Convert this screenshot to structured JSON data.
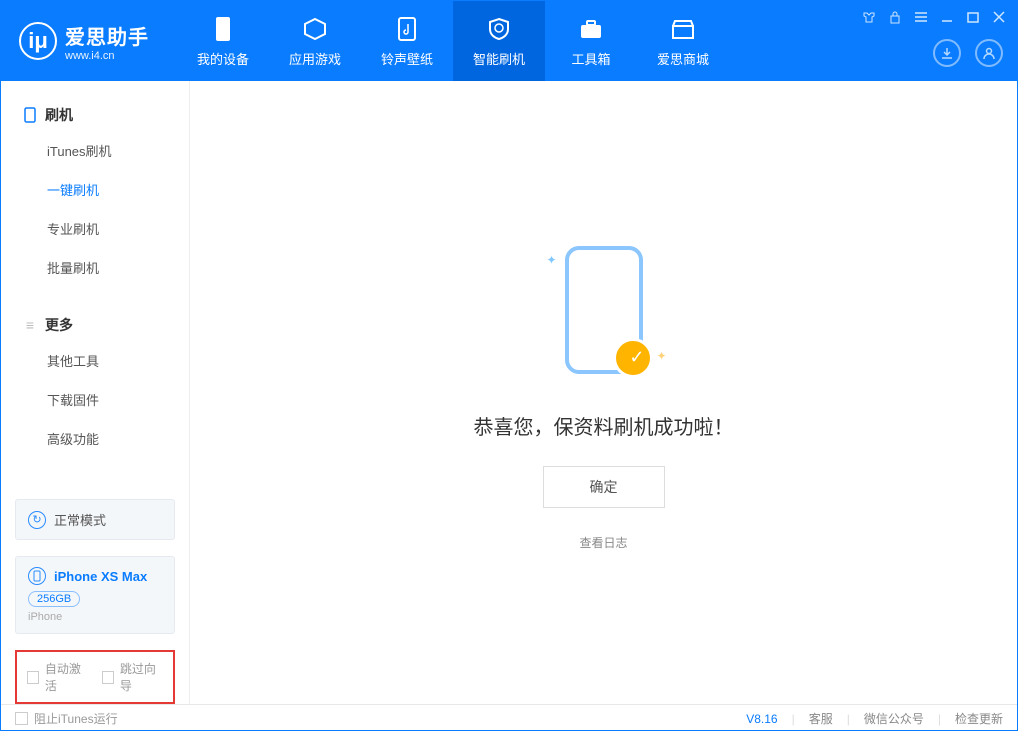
{
  "app": {
    "title": "爱思助手",
    "subtitle": "www.i4.cn"
  },
  "tabs": [
    {
      "label": "我的设备"
    },
    {
      "label": "应用游戏"
    },
    {
      "label": "铃声壁纸"
    },
    {
      "label": "智能刷机"
    },
    {
      "label": "工具箱"
    },
    {
      "label": "爱思商城"
    }
  ],
  "sidebar": {
    "group1": {
      "title": "刷机",
      "items": [
        "iTunes刷机",
        "一键刷机",
        "专业刷机",
        "批量刷机"
      ]
    },
    "group2": {
      "title": "更多",
      "items": [
        "其他工具",
        "下载固件",
        "高级功能"
      ]
    }
  },
  "status": {
    "mode": "正常模式"
  },
  "device": {
    "name": "iPhone XS Max",
    "storage": "256GB",
    "type": "iPhone"
  },
  "options": {
    "opt1": "自动激活",
    "opt2": "跳过向导"
  },
  "main": {
    "message": "恭喜您，保资料刷机成功啦！",
    "confirm": "确定",
    "log": "查看日志"
  },
  "footer": {
    "blockItunes": "阻止iTunes运行",
    "version": "V8.16",
    "links": [
      "客服",
      "微信公众号",
      "检查更新"
    ]
  }
}
